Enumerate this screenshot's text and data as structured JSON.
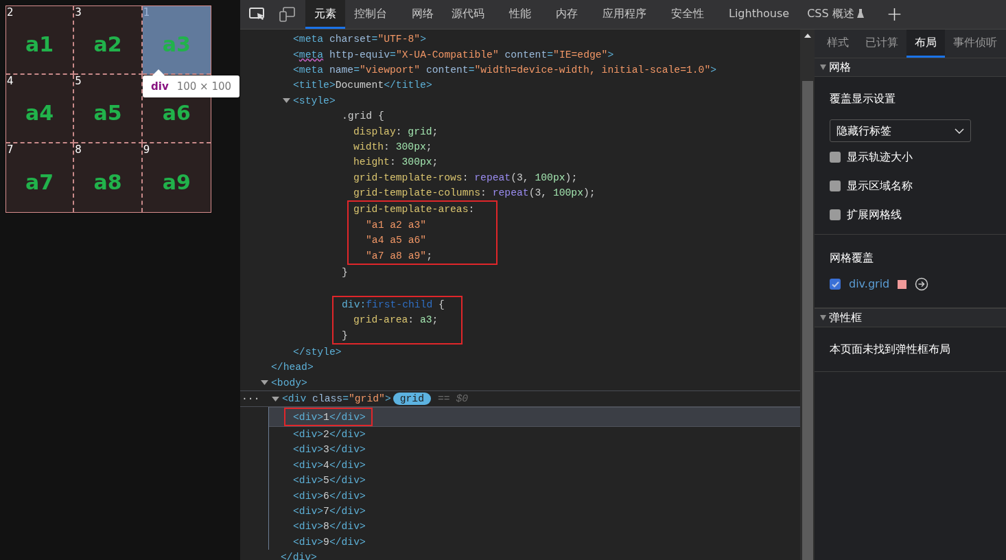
{
  "page": {
    "cells": [
      {
        "number": "2",
        "label": "a1",
        "highlighted": false
      },
      {
        "number": "3",
        "label": "a2",
        "highlighted": false
      },
      {
        "number": "1",
        "label": "a3",
        "highlighted": true
      },
      {
        "number": "4",
        "label": "a4",
        "highlighted": false
      },
      {
        "number": "5",
        "label": "a5",
        "highlighted": false
      },
      {
        "label": "a6",
        "highlighted": false
      },
      {
        "number": "7",
        "label": "a7",
        "highlighted": false
      },
      {
        "number": "8",
        "label": "a8",
        "highlighted": false
      },
      {
        "number": "9",
        "label": "a9",
        "highlighted": false
      }
    ],
    "tooltip": {
      "tag": "div",
      "size": "100 × 100"
    }
  },
  "devtools": {
    "tabs": [
      {
        "label": "元素",
        "selected": true
      },
      {
        "label": "控制台",
        "selected": false
      },
      {
        "label": "网络",
        "selected": false
      },
      {
        "label": "源代码",
        "selected": false
      },
      {
        "label": "性能",
        "selected": false
      },
      {
        "label": "内存",
        "selected": false
      },
      {
        "label": "应用程序",
        "selected": false
      },
      {
        "label": "安全性",
        "selected": false
      },
      {
        "label": "Lighthouse",
        "selected": false
      },
      {
        "label": "CSS 概述",
        "selected": false,
        "experimental": true
      }
    ],
    "add_tab": "+",
    "dom": [
      {
        "end": "</head>",
        "children": [
          {
            "kind": "html",
            "text": "<meta charset=\"UTF-8\">"
          },
          {
            "kind": "html",
            "warning": true,
            "text": "<meta http-equiv=\"X-UA-Compatible\" content=\"IE=edge\">"
          },
          {
            "kind": "html",
            "text": "<meta name=\"viewport\" content=\"width=device-width, initial-scale=1.0\">"
          },
          {
            "kind": "html",
            "text": "<title>Document</title>"
          },
          {
            "kind": "style",
            "expanded": true,
            "text": "<style>",
            "end": "</style>",
            "children": [
              {
                "kind": "selector",
                "text": ".grid {",
                "end": "}",
                "children": [
                  {
                    "kind": "decl",
                    "text": "display: grid;"
                  },
                  {
                    "kind": "decl",
                    "text": "width: 300px;"
                  },
                  {
                    "kind": "decl",
                    "text": "height: 300px;"
                  },
                  {
                    "kind": "decl",
                    "text": "grid-template-rows: repeat(3, 100px);"
                  },
                  {
                    "kind": "decl",
                    "text": "grid-template-columns: repeat(3, 100px);"
                  },
                  {
                    "kind": "decl",
                    "boxed": true,
                    "text": "grid-template-areas:",
                    "children": [
                      {
                        "kind": "string",
                        "text": "\"a1 a2 a3\""
                      },
                      {
                        "kind": "string",
                        "text": "\"a4 a5 a6\""
                      },
                      {
                        "kind": "string",
                        "text": "\"a7 a8 a9\";"
                      }
                    ]
                  }
                ]
              },
              {
                "kind": "blank"
              },
              {
                "kind": "selector",
                "boxed": true,
                "text": "div:first-child {",
                "end": "}",
                "children": [
                  {
                    "kind": "decl",
                    "text": "grid-area: a3;"
                  }
                ]
              }
            ]
          }
        ]
      },
      {
        "kind": "html",
        "expanded": true,
        "text": "<body>",
        "children": [
          {
            "kind": "html",
            "expanded": true,
            "selected": true,
            "more": "···",
            "text": "<div class=\"grid\">",
            "badge": "grid",
            "ref": "== $0",
            "end": "</div>",
            "children": [
              {
                "kind": "html",
                "boxed": true,
                "hovered": true,
                "text": "<div>1</div>"
              },
              {
                "kind": "html",
                "text": "<div>2</div>"
              },
              {
                "kind": "html",
                "text": "<div>3</div>"
              },
              {
                "kind": "html",
                "text": "<div>4</div>"
              },
              {
                "kind": "html",
                "text": "<div>5</div>"
              },
              {
                "kind": "html",
                "text": "<div>6</div>"
              },
              {
                "kind": "html",
                "text": "<div>7</div>"
              },
              {
                "kind": "html",
                "text": "<div>8</div>"
              },
              {
                "kind": "html",
                "text": "<div>9</div>"
              }
            ]
          }
        ]
      }
    ],
    "side_tabs": [
      {
        "label": "样式",
        "selected": false
      },
      {
        "label": "已计算",
        "selected": false
      },
      {
        "label": "布局",
        "selected": true
      },
      {
        "label": "事件侦听",
        "selected": false
      }
    ],
    "grid_section": {
      "title": "网格",
      "expanded": true,
      "overlay_heading": "覆盖显示设置",
      "dropdown": {
        "value": "隐藏行标签"
      },
      "options": [
        {
          "label": "显示轨迹大小",
          "checked": false
        },
        {
          "label": "显示区域名称",
          "checked": false
        },
        {
          "label": "扩展网格线",
          "checked": false
        }
      ],
      "overlays_heading": "网格覆盖",
      "overlays": [
        {
          "label": "div.grid",
          "checked": true,
          "color": "#f19a9a"
        }
      ]
    },
    "flex_section": {
      "title": "弹性框",
      "expanded": true,
      "message": "本页面未找到弹性框布局"
    }
  }
}
